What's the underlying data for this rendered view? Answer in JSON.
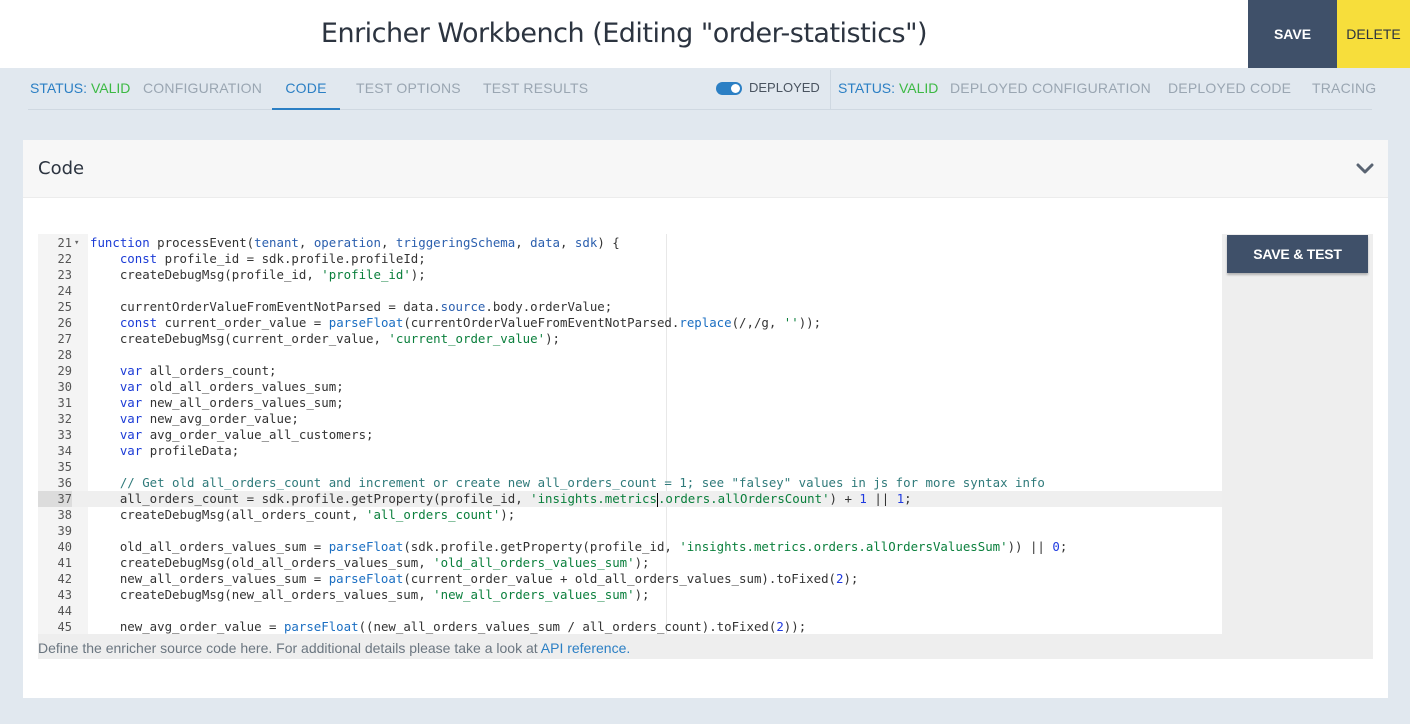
{
  "header": {
    "title": "Enricher Workbench (Editing \"order-statistics\")",
    "save_label": "SAVE",
    "delete_label": "DELETE"
  },
  "tabs_left": {
    "status_label": "STATUS:",
    "status_value": "VALID",
    "items": [
      "CONFIGURATION",
      "CODE",
      "TEST OPTIONS",
      "TEST RESULTS"
    ],
    "active": "CODE"
  },
  "deployed_toggle": {
    "label": "DEPLOYED",
    "on": true
  },
  "tabs_right": {
    "status_label": "STATUS:",
    "status_value": "VALID",
    "items": [
      "DEPLOYED CONFIGURATION",
      "DEPLOYED CODE",
      "TRACING"
    ]
  },
  "panel": {
    "title": "Code",
    "save_test_label": "SAVE & TEST",
    "help_text": "Define the enricher source code here. For additional details please take a look at",
    "help_link": "API reference."
  },
  "code": {
    "active_line": 37,
    "lines": [
      {
        "n": "21",
        "text": "function processEvent(tenant, operation, triggeringSchema, data, sdk) {"
      },
      {
        "n": "22",
        "text": "    const profile_id = sdk.profile.profileId;"
      },
      {
        "n": "23",
        "text": "    createDebugMsg(profile_id, 'profile_id');"
      },
      {
        "n": "24",
        "text": ""
      },
      {
        "n": "25",
        "text": "    currentOrderValueFromEventNotParsed = data.source.body.orderValue;"
      },
      {
        "n": "26",
        "text": "    const current_order_value = parseFloat(currentOrderValueFromEventNotParsed.replace(/,/g, ''));"
      },
      {
        "n": "27",
        "text": "    createDebugMsg(current_order_value, 'current_order_value');"
      },
      {
        "n": "28",
        "text": ""
      },
      {
        "n": "29",
        "text": "    var all_orders_count;"
      },
      {
        "n": "30",
        "text": "    var old_all_orders_values_sum;"
      },
      {
        "n": "31",
        "text": "    var new_all_orders_values_sum;"
      },
      {
        "n": "32",
        "text": "    var new_avg_order_value;"
      },
      {
        "n": "33",
        "text": "    var avg_order_value_all_customers;"
      },
      {
        "n": "34",
        "text": "    var profileData;"
      },
      {
        "n": "35",
        "text": ""
      },
      {
        "n": "36",
        "text": "    // Get old all_orders_count and increment or create new all_orders_count = 1; see \"falsey\" values in js for more syntax info"
      },
      {
        "n": "37",
        "text": "    all_orders_count = sdk.profile.getProperty(profile_id, 'insights.metrics.orders.allOrdersCount') + 1 || 1;"
      },
      {
        "n": "38",
        "text": "    createDebugMsg(all_orders_count, 'all_orders_count');"
      },
      {
        "n": "39",
        "text": ""
      },
      {
        "n": "40",
        "text": "    old_all_orders_values_sum = parseFloat(sdk.profile.getProperty(profile_id, 'insights.metrics.orders.allOrdersValuesSum')) || 0;"
      },
      {
        "n": "41",
        "text": "    createDebugMsg(old_all_orders_values_sum, 'old_all_orders_values_sum');"
      },
      {
        "n": "42",
        "text": "    new_all_orders_values_sum = parseFloat(current_order_value + old_all_orders_values_sum).toFixed(2);"
      },
      {
        "n": "43",
        "text": "    createDebugMsg(new_all_orders_values_sum, 'new_all_orders_values_sum');"
      },
      {
        "n": "44",
        "text": ""
      },
      {
        "n": "45",
        "text": "    new_avg_order_value = parseFloat((new_all_orders_values_sum / all_orders_count).toFixed(2));"
      }
    ]
  },
  "colors": {
    "accent": "#2b7fc4",
    "valid": "#3cb944",
    "save_bg": "#3f5069",
    "delete_bg": "#f7de3b"
  }
}
